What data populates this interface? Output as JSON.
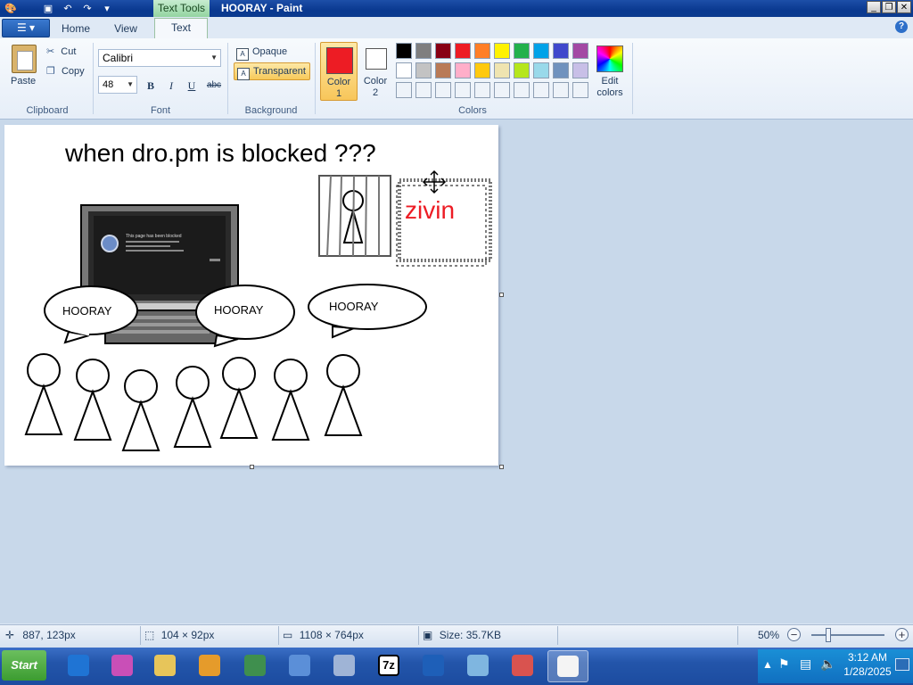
{
  "window": {
    "title": "HOORAY - Paint",
    "context_tab": "Text Tools"
  },
  "tabs": {
    "home": "Home",
    "view": "View",
    "text": "Text"
  },
  "clipboard": {
    "paste": "Paste",
    "cut": "Cut",
    "copy": "Copy",
    "group": "Clipboard"
  },
  "font": {
    "name": "Calibri",
    "size": "48",
    "bold": "B",
    "italic": "I",
    "underline": "U",
    "strikethrough": "abc",
    "group": "Font"
  },
  "background": {
    "opaque": "Opaque",
    "transparent": "Transparent",
    "group": "Background"
  },
  "colors": {
    "color1_line1": "Color",
    "color1_line2": "1",
    "color2_line1": "Color",
    "color2_line2": "2",
    "edit_line1": "Edit",
    "edit_line2": "colors",
    "group": "Colors",
    "color1": "#ed1c24",
    "color2": "#ffffff",
    "palette_row1": [
      "#000000",
      "#7f7f7f",
      "#880015",
      "#ed1c24",
      "#ff7f27",
      "#fff200",
      "#22b14c",
      "#00a2e8",
      "#3f48cc",
      "#a349a4"
    ],
    "palette_row2": [
      "#ffffff",
      "#c3c3c3",
      "#b97a57",
      "#ffaec9",
      "#ffc90e",
      "#efe4b0",
      "#b5e61d",
      "#99d9ea",
      "#7092be",
      "#c8bfe7"
    ]
  },
  "drawing": {
    "title": "when dro.pm is blocked ???",
    "selection_text": "zivin",
    "bubble1": "HOORAY",
    "bubble2": "HOORAY",
    "bubble3": "HOORAY",
    "screen_text": "This page has been blocked"
  },
  "status": {
    "cursor": "887, 123px",
    "selection": "104 × 92px",
    "canvas_size": "1108 × 764px",
    "file_size": "Size: 35.7KB",
    "zoom": "50%"
  },
  "taskbar": {
    "start": "Start",
    "time": "3:12 AM",
    "date": "1/28/2025",
    "icons": [
      "internet-explorer-icon",
      "cat-app-icon",
      "folder-icon",
      "media-player-icon",
      "globe-icon",
      "remote-desktop-icon",
      "cd-tool-icon",
      "7zip-icon",
      "filezilla-icon",
      "notepad-icon",
      "snipping-tool-icon",
      "paint-icon"
    ],
    "seven_zip_label": "7z"
  }
}
